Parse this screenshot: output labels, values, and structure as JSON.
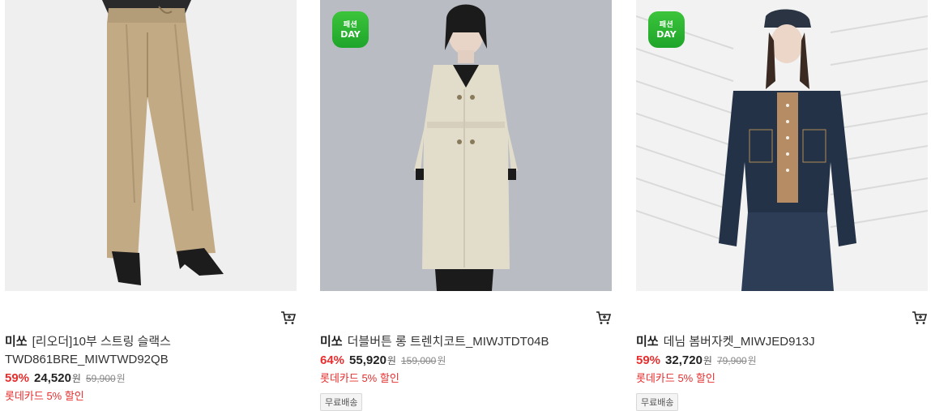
{
  "products": [
    {
      "brand": "미쏘",
      "name": "[리오더]10부 스트링 슬랙스 TWD861BRE_MIWTWD92QB",
      "discount": "59%",
      "price": "24,520",
      "won": "원",
      "original_price": "59,900",
      "original_won": "원",
      "promo": "롯데카드 5% 할인",
      "badge_line1": "",
      "badge_line2": "",
      "image": "beige-wide-slacks-photo"
    },
    {
      "brand": "미쏘",
      "name": "더블버튼 롱 트렌치코트_MIWJTDT04B",
      "discount": "64%",
      "price": "55,920",
      "won": "원",
      "original_price": "159,000",
      "original_won": "원",
      "promo": "롯데카드 5% 할인",
      "shipping": "무료배송",
      "badge_line1": "패션",
      "badge_line2": "DAY",
      "image": "beige-trench-coat-photo"
    },
    {
      "brand": "미쏘",
      "name": "데님 봄버자켓_MIWJED913J",
      "discount": "59%",
      "price": "32,720",
      "won": "원",
      "original_price": "79,900",
      "original_won": "원",
      "promo": "롯데카드 5% 할인",
      "shipping": "무료배송",
      "badge_line1": "패션",
      "badge_line2": "DAY",
      "image": "denim-bomber-jacket-photo"
    }
  ],
  "colors": {
    "discount": "#e62e2e",
    "badge": "#22b02c"
  }
}
